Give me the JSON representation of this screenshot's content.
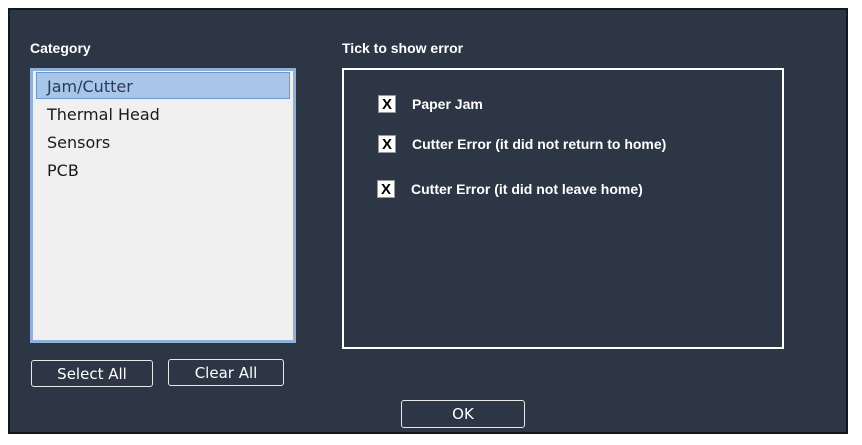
{
  "category": {
    "heading": "Category",
    "items": [
      "Jam/Cutter",
      "Thermal Head",
      "Sensors",
      "PCB"
    ],
    "selected_index": 0
  },
  "errors": {
    "heading": "Tick to show error",
    "items": [
      {
        "label": "Paper Jam",
        "mark": "X",
        "checked": true
      },
      {
        "label": "Cutter Error (it did not return to home)",
        "mark": "X",
        "checked": true
      },
      {
        "label": "Cutter Error (it did not leave home)",
        "mark": "X",
        "checked": true
      }
    ]
  },
  "buttons": {
    "select_all": "Select All",
    "clear_all": "Clear All",
    "ok": "OK"
  },
  "colors": {
    "background": "#2c3644",
    "list_background": "#f0f0f0",
    "selection": "#a8c6ea",
    "list_border": "#8fb0d8"
  }
}
